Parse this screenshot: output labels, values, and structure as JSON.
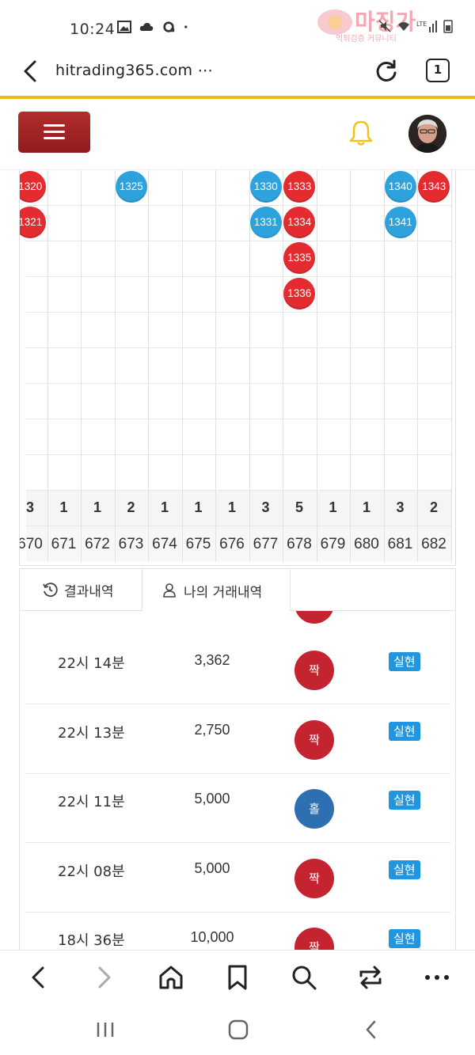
{
  "status": {
    "time": "10:24"
  },
  "watermark": {
    "text": "마징가",
    "sub": "먹튀검증 커뮤니티"
  },
  "browser": {
    "url": "hitrading365.com ⋯",
    "tab_count": "1"
  },
  "grid": {
    "balls": [
      {
        "label": "1320",
        "color": "red",
        "col": 0,
        "row": 0
      },
      {
        "label": "1321",
        "color": "red",
        "col": 0,
        "row": 1
      },
      {
        "label": "1325",
        "color": "blue",
        "col": 3,
        "row": 0
      },
      {
        "label": "1330",
        "color": "blue",
        "col": 7,
        "row": 0
      },
      {
        "label": "1331",
        "color": "blue",
        "col": 7,
        "row": 1
      },
      {
        "label": "1333",
        "color": "red",
        "col": 8,
        "row": 0
      },
      {
        "label": "1334",
        "color": "red",
        "col": 8,
        "row": 1
      },
      {
        "label": "1335",
        "color": "red",
        "col": 8,
        "row": 2
      },
      {
        "label": "1336",
        "color": "red",
        "col": 8,
        "row": 3
      },
      {
        "label": "1340",
        "color": "blue",
        "col": 11,
        "row": 0
      },
      {
        "label": "1341",
        "color": "blue",
        "col": 11,
        "row": 1
      },
      {
        "label": "1343",
        "color": "red",
        "col": 12,
        "row": 0
      }
    ],
    "counts": [
      "3",
      "1",
      "1",
      "2",
      "1",
      "1",
      "1",
      "3",
      "5",
      "1",
      "1",
      "3",
      "2"
    ],
    "numbers": [
      "670",
      "671",
      "672",
      "673",
      "674",
      "675",
      "676",
      "677",
      "678",
      "679",
      "680",
      "681",
      "682"
    ]
  },
  "tabs": {
    "results": "결과내역",
    "my_history": "나의 거래내역"
  },
  "history": [
    {
      "time": "22시 14분",
      "amount": "3,362",
      "result": "짝",
      "result_color": "red",
      "type": "실현"
    },
    {
      "time": "22시 13분",
      "amount": "2,750",
      "result": "짝",
      "result_color": "red",
      "type": "실현"
    },
    {
      "time": "22시 11분",
      "amount": "5,000",
      "result": "홀",
      "result_color": "blue",
      "type": "실현"
    },
    {
      "time": "22시 08분",
      "amount": "5,000",
      "result": "짝",
      "result_color": "red",
      "type": "실현"
    },
    {
      "time": "18시 36분",
      "amount": "10,000",
      "result": "짝",
      "result_color": "red",
      "type": "실현"
    }
  ],
  "colors": {
    "accent_yellow": "#f0b90b",
    "menu_red": "#a52525",
    "ball_red": "#e32b30",
    "ball_blue": "#2ea2dd",
    "badge_blue": "#2196e0"
  }
}
